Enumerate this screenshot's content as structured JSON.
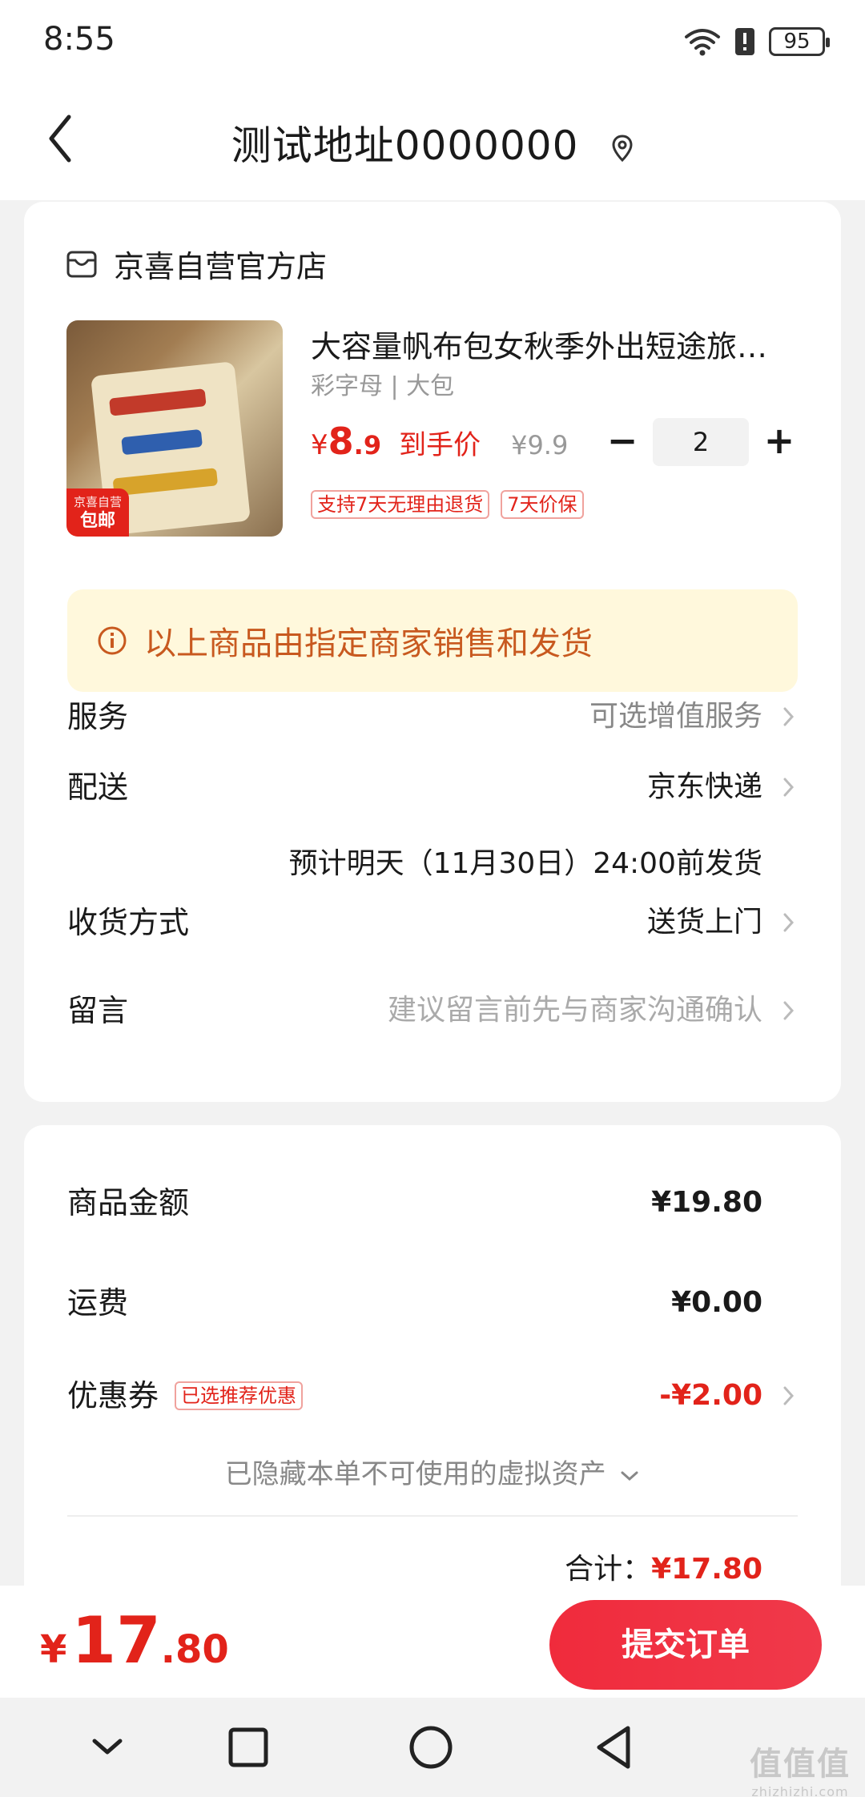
{
  "status_bar": {
    "time": "8:55",
    "battery": "95"
  },
  "header": {
    "title": "测试地址0000000"
  },
  "store": {
    "name": "京喜自营官方店"
  },
  "product": {
    "title": "大容量帆布包女秋季外出短途旅…",
    "spec": "彩字母 | 大包",
    "badge_line1": "京喜自营",
    "badge_line2": "包邮",
    "price_symbol": "¥",
    "price_int": "8",
    "price_dec": ".9",
    "price_label": "到手价",
    "original_price": "¥9.9",
    "quantity": "2",
    "minus_label": "−",
    "plus_label": "+",
    "tags": [
      "支持7天无理由退货",
      "7天价保"
    ]
  },
  "notice": {
    "text": "以上商品由指定商家销售和发货"
  },
  "rows": {
    "service": {
      "label": "服务",
      "value": "可选增值服务"
    },
    "delivery": {
      "label": "配送",
      "value": "京东快递",
      "sub": "预计明天（11月30日）24:00前发货"
    },
    "receive": {
      "label": "收货方式",
      "value": "送货上门"
    },
    "message": {
      "label": "留言",
      "placeholder": "建议留言前先与商家沟通确认"
    }
  },
  "fees": {
    "goods": {
      "label": "商品金额",
      "value": "¥19.80"
    },
    "shipping": {
      "label": "运费",
      "value": "¥0.00"
    },
    "coupon": {
      "label": "优惠券",
      "tag": "已选推荐优惠",
      "value": "-¥2.00"
    },
    "hidden_assets": "已隐藏本单不可使用的虚拟资产",
    "total_label": "合计：",
    "total_value": "¥17.80"
  },
  "bottom": {
    "price_symbol": "¥",
    "price_int": "17",
    "price_dec": ".80",
    "submit_label": "提交订单"
  },
  "watermark": {
    "line1": "值值值",
    "line2": "zhizhizhi.com"
  },
  "colors": {
    "accent": "#e2231a",
    "notice_text": "#c8591f",
    "notice_bg": "#fff8dc"
  }
}
